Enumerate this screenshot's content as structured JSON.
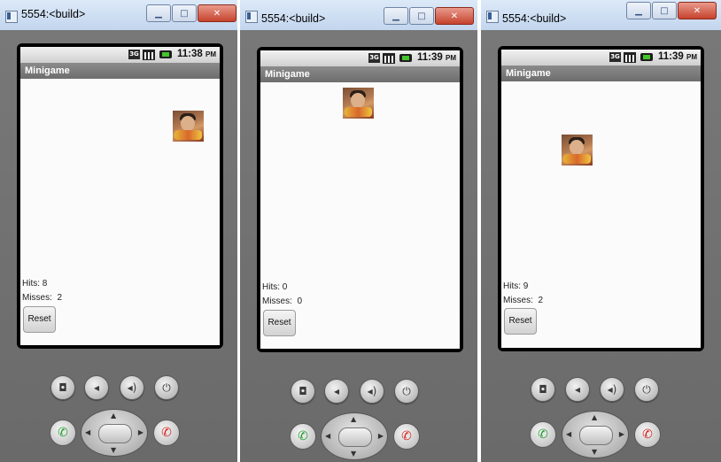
{
  "windows": [
    {
      "title": "5554:<build>",
      "time": "11:38",
      "ampm": "PM",
      "app_title": "Minigame",
      "hits_label": "Hits: 8",
      "misses_label": "Misses:  2",
      "reset_label": "Reset"
    },
    {
      "title": "5554:<build>",
      "time": "11:39",
      "ampm": "PM",
      "app_title": "Minigame",
      "hits_label": "Hits: 0",
      "misses_label": "Misses:  0",
      "reset_label": "Reset"
    },
    {
      "title": "5554:<build>",
      "time": "11:39",
      "ampm": "PM",
      "app_title": "Minigame",
      "hits_label": "Hits: 9",
      "misses_label": "Misses:  2",
      "reset_label": "Reset"
    }
  ],
  "status_icons": [
    "network-3g-icon",
    "signal-icon",
    "battery-icon"
  ],
  "hardware_buttons": [
    "camera-icon",
    "volume-down-icon",
    "volume-up-icon",
    "power-icon",
    "call-icon",
    "dpad",
    "end-call-icon"
  ],
  "colors": {
    "call_green": "#1e9a2a",
    "end_red": "#d0201c",
    "emulator_gray": "#7b7b7b"
  }
}
